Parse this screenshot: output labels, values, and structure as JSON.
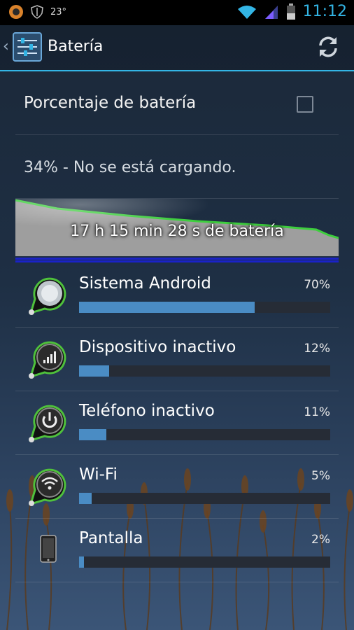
{
  "status_bar": {
    "temperature": "23°",
    "time": "11:12"
  },
  "action_bar": {
    "title": "Batería"
  },
  "settings": {
    "percentage_label": "Porcentaje de batería",
    "percentage_checked": false
  },
  "battery_status": {
    "text": "34% - No se está cargando."
  },
  "graph": {
    "label": "17 h 15 min 28 s de batería"
  },
  "usage": [
    {
      "name": "Sistema Android",
      "percent": "70%",
      "fraction": 0.7,
      "icon": "android-system-icon"
    },
    {
      "name": "Dispositivo inactivo",
      "percent": "12%",
      "fraction": 0.12,
      "icon": "signal-bars-icon"
    },
    {
      "name": "Teléfono inactivo",
      "percent": "11%",
      "fraction": 0.11,
      "icon": "power-icon"
    },
    {
      "name": "Wi-Fi",
      "percent": "5%",
      "fraction": 0.05,
      "icon": "wifi-icon"
    },
    {
      "name": "Pantalla",
      "percent": "2%",
      "fraction": 0.02,
      "icon": "phone-screen-icon"
    }
  ],
  "colors": {
    "accent": "#33b5e5",
    "bar_fill": "#4a8cc4",
    "graph_line": "#3ecf3e"
  }
}
